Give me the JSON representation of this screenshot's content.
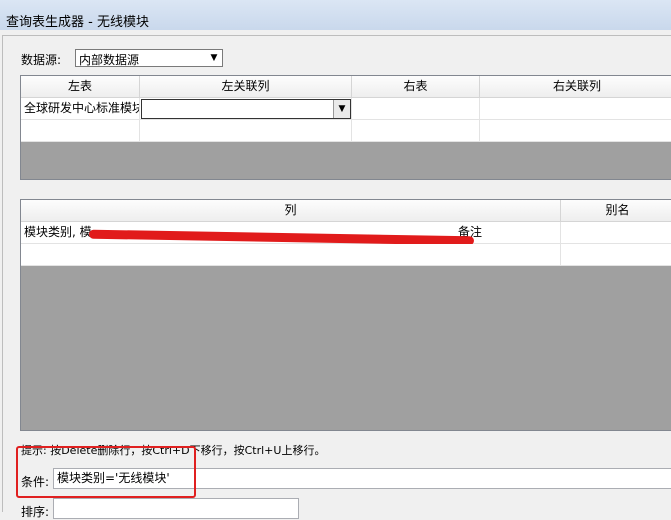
{
  "window": {
    "title": "查询表生成器 - 无线模块"
  },
  "datasource": {
    "label": "数据源:",
    "value": "内部数据源"
  },
  "join_table": {
    "columns": [
      "左表",
      "左关联列",
      "右表",
      "右关联列"
    ],
    "rows": [
      {
        "left_table": "全球研发中心标准模块",
        "left_column": "",
        "right_table": "",
        "right_column": ""
      }
    ]
  },
  "column_table": {
    "columns": [
      "列",
      "别名"
    ],
    "rows": [
      {
        "column": "模块类别, 模",
        "alias": ""
      }
    ],
    "visible_tail": "备注"
  },
  "hint": {
    "text": "提示: 按Delete删除行，按Ctrl+D下移行，按Ctrl+U上移行。"
  },
  "condition": {
    "label": "条件:",
    "value": "模块类别='无线模块'"
  },
  "sort": {
    "label": "排序:"
  },
  "colors": {
    "grid_bg": "#a0a0a0",
    "highlight": "#e02020"
  }
}
